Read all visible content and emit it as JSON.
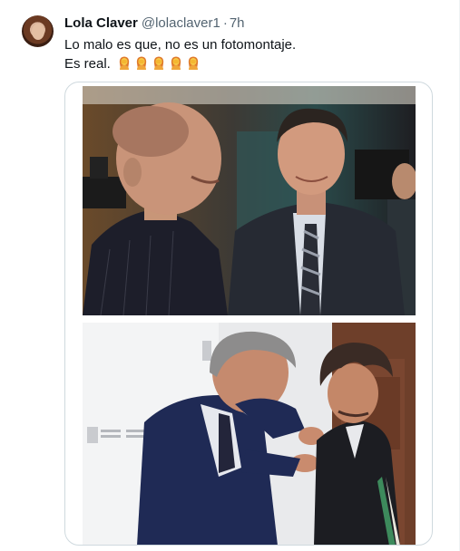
{
  "tweet": {
    "author_name": "Lola Claver",
    "handle": "@lolaclaver1",
    "separator": "·",
    "time": "7h",
    "line1": "Lo malo es que, no es un fotomontaje.",
    "line2": "Es real.",
    "emoji_count": 5,
    "emoji_icon": "woman-facepalming-icon"
  },
  "media": {
    "photo1_kind": "photo",
    "photo2_kind": "photo"
  },
  "colors": {
    "text_primary": "#0f1419",
    "text_secondary": "#536471",
    "border": "#cfd9de"
  }
}
